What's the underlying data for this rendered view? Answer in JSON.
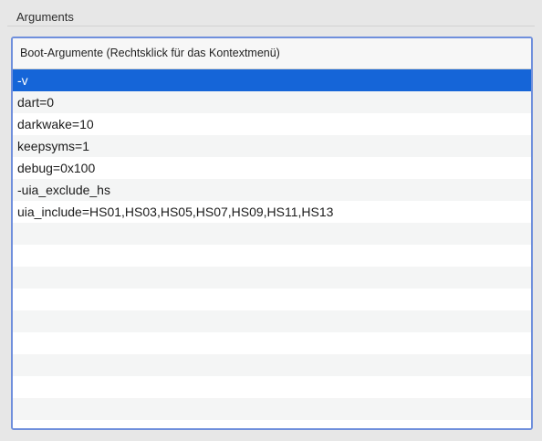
{
  "section": {
    "title": "Arguments"
  },
  "table": {
    "column_header": "Boot-Argumente (Rechtsklick für das Kontextmenü)",
    "rows": [
      "-v",
      "dart=0",
      "darkwake=10",
      "keepsyms=1",
      "debug=0x100",
      "-uia_exclude_hs",
      "uia_include=HS01,HS03,HS05,HS07,HS09,HS11,HS13",
      "",
      "",
      "",
      "",
      "",
      "",
      "",
      "",
      "",
      ""
    ],
    "selected_index": 0
  },
  "colors": {
    "selection": "#1565d8",
    "focus_ring": "#6f8fdc"
  }
}
